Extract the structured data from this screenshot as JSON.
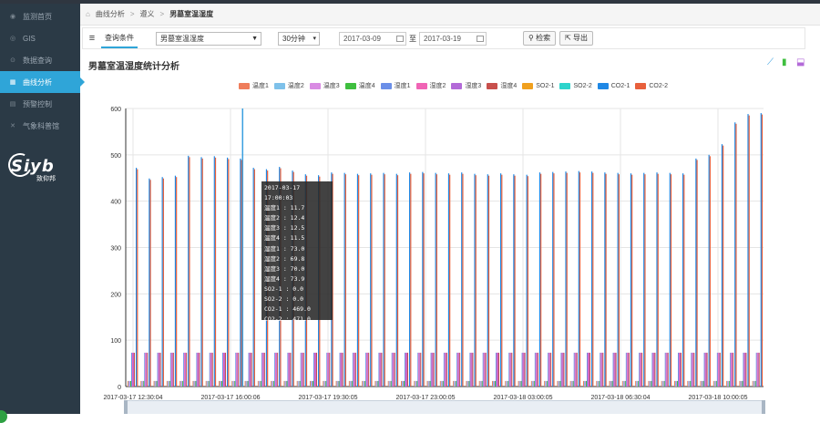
{
  "sidebar": {
    "items": [
      {
        "label": "监测首页",
        "icon": "home-icon",
        "glyph": "◉"
      },
      {
        "label": "GIS",
        "icon": "map-icon",
        "glyph": "◎"
      },
      {
        "label": "数据查询",
        "icon": "search-icon",
        "glyph": "⊙"
      },
      {
        "label": "曲线分析",
        "icon": "chart-icon",
        "glyph": "▦"
      },
      {
        "label": "预警控制",
        "icon": "alarm-icon",
        "glyph": "▤"
      },
      {
        "label": "气象科普馆",
        "icon": "weather-icon",
        "glyph": "✕"
      }
    ],
    "logo": {
      "text": "Siyb",
      "sub": "致仰邦"
    }
  },
  "breadcrumb": {
    "home_icon": "home-icon",
    "items": [
      "曲线分析",
      "遵义",
      "男墓室温湿度"
    ]
  },
  "toolbar": {
    "title": "查询条件",
    "point_select": "男墓室温湿度",
    "interval_select": "30分钟",
    "date_from": "2017-03-09",
    "to_label": "至",
    "date_to": "2017-03-19",
    "search_label": "检索",
    "export_label": "导出"
  },
  "chart_header": {
    "title": "男墓室温湿度统计分析",
    "icons": [
      "line-chart-icon",
      "bar-chart-icon",
      "save-icon"
    ]
  },
  "tooltip": {
    "time": "2017-03-17 17:00:03",
    "rows": [
      "温度1 : 11.7",
      "温度2 : 12.4",
      "温度3 : 12.5",
      "温度4 : 11.5",
      "湿度1 : 73.0",
      "湿度2 : 69.8",
      "湿度3 : 70.0",
      "湿度4 : 73.9",
      "SO2-1 : 0.0",
      "SO2-2 : 0.0",
      "CO2-1 : 469.0",
      "CO2-2 : 471.0"
    ]
  },
  "colors": {
    "sidebar_bg": "#2b3a46",
    "accent": "#2fa5d8",
    "series": [
      "#ef7d5b",
      "#7ec1ea",
      "#d98be3",
      "#3fbf3f",
      "#6b8fe8",
      "#f064b5",
      "#b36ad8",
      "#c8504c",
      "#f0a01e",
      "#2ed4cc",
      "#1f88e5",
      "#e8603c"
    ]
  },
  "chart_data": {
    "type": "bar",
    "legend": [
      "温度1",
      "温度2",
      "温度3",
      "温度4",
      "湿度1",
      "湿度2",
      "湿度3",
      "湿度4",
      "SO2-1",
      "SO2-2",
      "CO2-1",
      "CO2-2"
    ],
    "y_ticks": [
      0,
      100,
      200,
      300,
      400,
      500,
      600
    ],
    "ylim": [
      0,
      600
    ],
    "x_tick_labels": [
      "2017-03-17 12:30:04",
      "2017-03-17 16:00:06",
      "2017-03-17 19:30:05",
      "2017-03-17 23:00:05",
      "2017-03-18 03:00:05",
      "2017-03-18 06:30:04",
      "2017-03-18 10:00:05"
    ],
    "groups": 49,
    "temperature_approx": 12,
    "humidity_approx": 73,
    "so2_approx": 0,
    "co2": [
      472,
      449,
      452,
      455,
      498,
      495,
      497,
      494,
      492,
      472,
      469,
      474,
      466,
      458,
      456,
      462,
      461,
      459,
      460,
      461,
      459,
      462,
      463,
      461,
      460,
      462,
      459,
      458,
      460,
      458,
      457,
      462,
      463,
      464,
      465,
      464,
      462,
      461,
      460,
      461,
      462,
      461,
      460,
      492,
      500,
      523,
      570,
      588,
      590
    ],
    "grid": true,
    "legend_position": "top-center"
  }
}
